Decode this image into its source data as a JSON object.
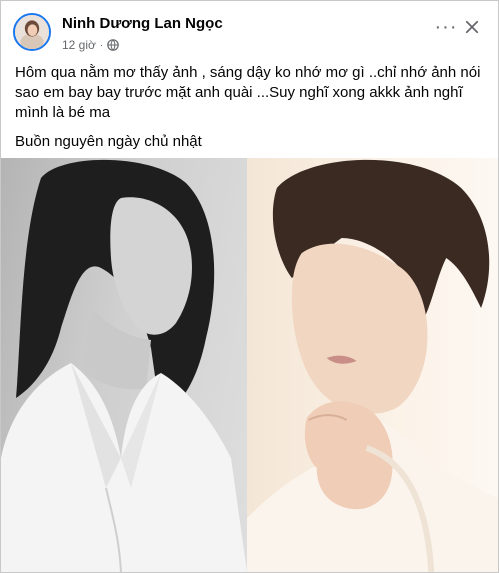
{
  "post": {
    "author": "Ninh Dương Lan Ngọc",
    "time": "12 giờ",
    "separator": "·",
    "more_symbol": "···",
    "text_line_1": "Hôm qua nằm mơ thấy ảnh , sáng dậy ko nhớ mơ gì ..chỉ nhớ ảnh nói sao em bay bay trước mặt anh quài ...Suy nghĩ xong akkk ảnh nghĩ mình là bé ma",
    "text_line_2": "Buồn nguyên ngày chủ nhật"
  },
  "icons": {
    "avatar": "profile-avatar",
    "audience": "globe-icon",
    "more": "more-options-icon",
    "close": "close-icon"
  },
  "colors": {
    "author_text": "#050505",
    "meta_text": "#65676b",
    "avatar_ring": "#1877f2",
    "border": "#c8c8c8"
  }
}
